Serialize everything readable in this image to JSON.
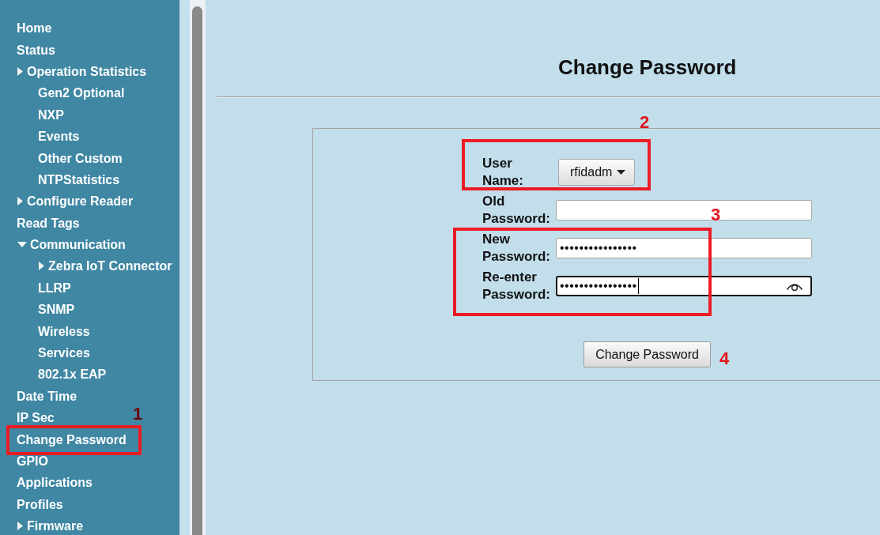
{
  "sidebar": {
    "items": [
      {
        "label": "Home"
      },
      {
        "label": "Status"
      },
      {
        "label": "Operation Statistics",
        "expanded": false,
        "children": [
          {
            "label": "Gen2 Optional"
          },
          {
            "label": "NXP"
          },
          {
            "label": "Events"
          },
          {
            "label": "Other Custom"
          },
          {
            "label": "NTPStatistics"
          }
        ]
      },
      {
        "label": "Configure Reader",
        "expanded": false
      },
      {
        "label": "Read Tags"
      },
      {
        "label": "Communication",
        "expanded": true,
        "children": [
          {
            "label": "Zebra IoT Connector",
            "expanded": false
          },
          {
            "label": "LLRP"
          },
          {
            "label": "SNMP"
          },
          {
            "label": "Wireless"
          },
          {
            "label": "Services"
          },
          {
            "label": "802.1x EAP"
          }
        ]
      },
      {
        "label": "Date Time"
      },
      {
        "label": "IP Sec"
      },
      {
        "label": "Change Password"
      },
      {
        "label": "GPIO"
      },
      {
        "label": "Applications"
      },
      {
        "label": "Profiles"
      },
      {
        "label": "Firmware",
        "expanded": false
      }
    ]
  },
  "page": {
    "title": "Change Password"
  },
  "form": {
    "user_name": {
      "label": "User Name:",
      "value": "rfidadm"
    },
    "fields": [
      {
        "label": "Old Password:",
        "focused": false
      },
      {
        "label": "New Password:",
        "value": "••••••••••••••••",
        "focused": false
      },
      {
        "label": "Re-enter Password:",
        "value": "••••••••••••••••",
        "focused": true
      }
    ],
    "submit_button": "Change Password"
  },
  "annotations": [
    {
      "label": "1",
      "kind": "box"
    },
    {
      "label": "2",
      "kind": "box"
    },
    {
      "label": "3",
      "kind": "box"
    },
    {
      "label": "4",
      "kind": "number"
    }
  ]
}
